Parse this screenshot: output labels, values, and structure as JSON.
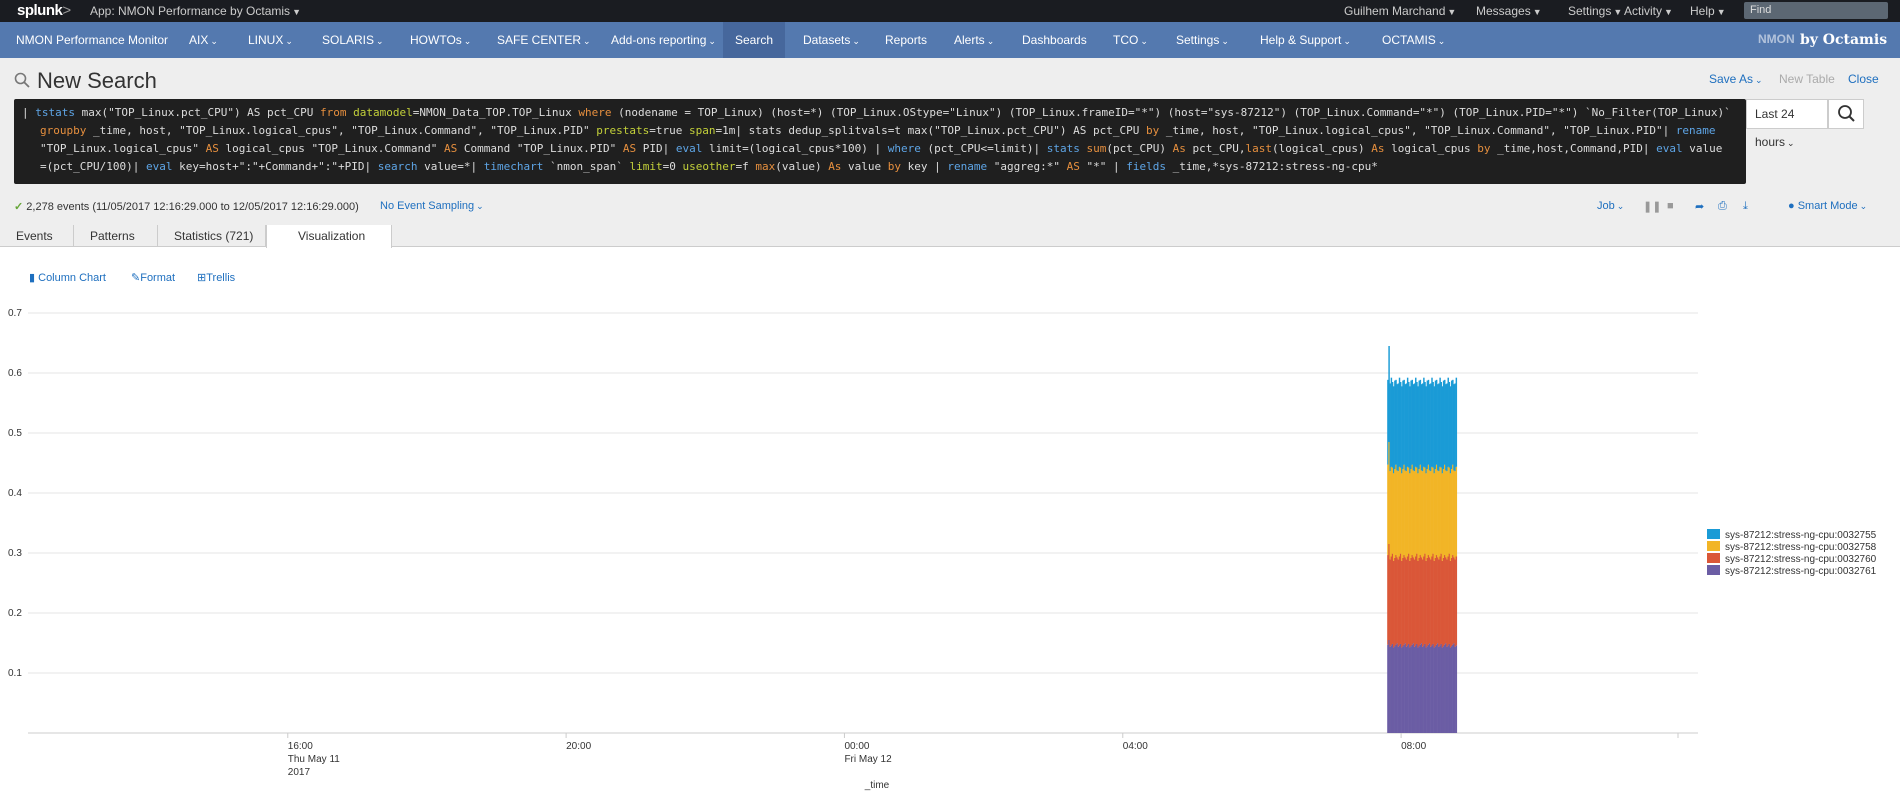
{
  "system_bar": {
    "logo": "splunk",
    "logo_suffix": ">",
    "app_selector": "App: NMON Performance by Octamis",
    "user": "Guilhem Marchand",
    "messages": "Messages",
    "settings": "Settings",
    "activity": "Activity",
    "help": "Help",
    "find_placeholder": "Find"
  },
  "app_nav": {
    "items": [
      {
        "label": "NMON Performance Monitor",
        "dropdown": false
      },
      {
        "label": "AIX",
        "dropdown": true
      },
      {
        "label": "LINUX",
        "dropdown": true
      },
      {
        "label": "SOLARIS",
        "dropdown": true
      },
      {
        "label": "HOWTOs",
        "dropdown": true
      },
      {
        "label": "SAFE CENTER",
        "dropdown": true
      },
      {
        "label": "Add-ons reporting",
        "dropdown": true
      },
      {
        "label": "Search",
        "dropdown": false,
        "active": true
      },
      {
        "label": "Datasets",
        "dropdown": true
      },
      {
        "label": "Reports",
        "dropdown": false
      },
      {
        "label": "Alerts",
        "dropdown": true
      },
      {
        "label": "Dashboards",
        "dropdown": false
      },
      {
        "label": "TCO",
        "dropdown": true
      },
      {
        "label": "Settings",
        "dropdown": true
      },
      {
        "label": "Help & Support",
        "dropdown": true
      },
      {
        "label": "OCTAMIS",
        "dropdown": true
      }
    ],
    "brand_nmon": "NMON",
    "brand_text": "by Octamis"
  },
  "search": {
    "title": "New Search",
    "save_as": "Save As",
    "new_table": "New Table",
    "close": "Close",
    "time_range": "Last 24 hours",
    "query_lines": [
      [
        [
          "t",
          "| "
        ],
        [
          "k",
          "tstats"
        ],
        [
          "t",
          " max(\"TOP_Linux.pct_CPU\") AS pct_CPU "
        ],
        [
          "f",
          "from"
        ],
        [
          "t",
          " "
        ],
        [
          "g",
          "datamodel"
        ],
        [
          "t",
          "=NMON_Data_TOP.TOP_Linux "
        ],
        [
          "f",
          "where"
        ],
        [
          "t",
          " (nodename = TOP_Linux) (host=*) (TOP_Linux.OStype=\"Linux\") (TOP_Linux.frameID=\"*\") (host=\"sys-87212\") (TOP_Linux.Command=\"*\") (TOP_Linux.PID=\"*\") `No_Filter(TOP_Linux)`"
        ]
      ],
      [
        [
          "f",
          "groupby"
        ],
        [
          "t",
          " _time, host, \"TOP_Linux.logical_cpus\", \"TOP_Linux.Command\", \"TOP_Linux.PID\" "
        ],
        [
          "g",
          "prestats"
        ],
        [
          "t",
          "=true "
        ],
        [
          "g",
          "span"
        ],
        [
          "t",
          "=1m| stats dedup_splitvals=t max(\"TOP_Linux.pct_CPU\") AS pct_CPU "
        ],
        [
          "f",
          "by"
        ],
        [
          "t",
          " _time, host, \"TOP_Linux.logical_cpus\", \"TOP_Linux.Command\", \"TOP_Linux.PID\"| "
        ],
        [
          "k",
          "rename"
        ]
      ],
      [
        [
          "t",
          "\"TOP_Linux.logical_cpus\" "
        ],
        [
          "f",
          "AS"
        ],
        [
          "t",
          " logical_cpus \"TOP_Linux.Command\" "
        ],
        [
          "f",
          "AS"
        ],
        [
          "t",
          " Command \"TOP_Linux.PID\" "
        ],
        [
          "f",
          "AS"
        ],
        [
          "t",
          " PID| "
        ],
        [
          "k",
          "eval"
        ],
        [
          "t",
          " limit=(logical_cpus*100) | "
        ],
        [
          "k",
          "where"
        ],
        [
          "t",
          " (pct_CPU<=limit)| "
        ],
        [
          "k",
          "stats"
        ],
        [
          "t",
          " "
        ],
        [
          "f",
          "sum"
        ],
        [
          "t",
          "(pct_CPU) "
        ],
        [
          "f",
          "As"
        ],
        [
          "t",
          " pct_CPU,"
        ],
        [
          "f",
          "last"
        ],
        [
          "t",
          "(logical_cpus) "
        ],
        [
          "f",
          "As"
        ],
        [
          "t",
          " logical_cpus "
        ],
        [
          "f",
          "by"
        ],
        [
          "t",
          " _time,host,Command,PID| "
        ],
        [
          "k",
          "eval"
        ],
        [
          "t",
          " value"
        ]
      ],
      [
        [
          "t",
          "=(pct_CPU/100)| "
        ],
        [
          "k",
          "eval"
        ],
        [
          "t",
          " key=host+\":\"+Command+\":\"+PID| "
        ],
        [
          "k",
          "search"
        ],
        [
          "t",
          " value=*| "
        ],
        [
          "k",
          "timechart"
        ],
        [
          "t",
          " `nmon_span` "
        ],
        [
          "g",
          "limit"
        ],
        [
          "t",
          "=0 "
        ],
        [
          "g",
          "useother"
        ],
        [
          "t",
          "=f "
        ],
        [
          "f",
          "max"
        ],
        [
          "t",
          "(value) "
        ],
        [
          "f",
          "As"
        ],
        [
          "t",
          " value "
        ],
        [
          "f",
          "by"
        ],
        [
          "t",
          " key | "
        ],
        [
          "k",
          "rename"
        ],
        [
          "t",
          " \"aggreg:*\" "
        ],
        [
          "f",
          "AS"
        ],
        [
          "t",
          " \"*\" | "
        ],
        [
          "k",
          "fields"
        ],
        [
          "t",
          " _time,*sys-87212:stress-ng-cpu*"
        ]
      ]
    ]
  },
  "status": {
    "events": "2,278 events (11/05/2017 12:16:29.000 to 12/05/2017 12:16:29.000)",
    "sampling": "No Event Sampling",
    "job": "Job",
    "mode": "Smart Mode"
  },
  "tabs": [
    {
      "label": "Events"
    },
    {
      "label": "Patterns"
    },
    {
      "label": "Statistics (721)"
    },
    {
      "label": "Visualization",
      "active": true
    }
  ],
  "viz_options": {
    "chart_type": "Column Chart",
    "format": "Format",
    "trellis": "Trellis"
  },
  "chart_data": {
    "type": "bar",
    "stacked": true,
    "xlabel": "_time",
    "ylabel": "",
    "ylim": [
      0,
      0.7
    ],
    "yticks": [
      0.1,
      0.2,
      0.3,
      0.4,
      0.5,
      0.6,
      0.7
    ],
    "x_range": [
      "2017-05-11 12:16",
      "2017-05-12 12:16"
    ],
    "x_ticks": [
      {
        "time": "2017-05-11 16:00",
        "lines": [
          "16:00",
          "Thu May 11",
          "2017"
        ]
      },
      {
        "time": "2017-05-11 20:00",
        "lines": [
          "20:00"
        ]
      },
      {
        "time": "2017-05-12 00:00",
        "lines": [
          "00:00",
          "Fri May 12"
        ]
      },
      {
        "time": "2017-05-12 04:00",
        "lines": [
          "04:00"
        ]
      },
      {
        "time": "2017-05-12 08:00",
        "lines": [
          "08:00"
        ]
      }
    ],
    "data_interval": {
      "start": "2017-05-12 07:48",
      "end": "2017-05-12 08:48",
      "span": "1m"
    },
    "legend_position": "right",
    "series": [
      {
        "name": "sys-87212:stress-ng-cpu:0032755",
        "color": "#1a9bd6",
        "approx_value": 0.145,
        "first_value": 0.16
      },
      {
        "name": "sys-87212:stress-ng-cpu:0032758",
        "color": "#f2b526",
        "approx_value": 0.147,
        "first_value": 0.17
      },
      {
        "name": "sys-87212:stress-ng-cpu:0032760",
        "color": "#da5738",
        "approx_value": 0.147,
        "first_value": 0.16
      },
      {
        "name": "sys-87212:stress-ng-cpu:0032761",
        "color": "#6b5da4",
        "approx_value": 0.146,
        "first_value": 0.155
      }
    ]
  }
}
